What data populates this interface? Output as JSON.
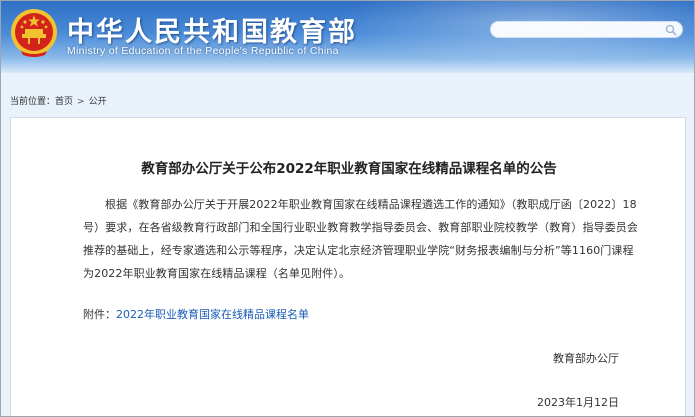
{
  "header": {
    "title": "中华人民共和国教育部",
    "subtitle": "Ministry of Education of the People's Republic of China",
    "search": {
      "value": "",
      "placeholder": ""
    }
  },
  "breadcrumb": {
    "prefix": "当前位置：",
    "items": [
      "首页",
      "公开"
    ],
    "separator": ">"
  },
  "article": {
    "title": "教育部办公厅关于公布2022年职业教育国家在线精品课程名单的公告",
    "body": "根据《教育部办公厅关于开展2022年职业教育国家在线精品课程遴选工作的通知》（教职成厅函〔2022〕18号）要求，在各省级教育行政部门和全国行业职业教育教学指导委员会、教育部职业院校教学（教育）指导委员会推荐的基础上，经专家遴选和公示等程序，决定认定北京经济管理职业学院“财务报表编制与分析”等1160门课程为2022年职业教育国家在线精品课程（名单见附件）。",
    "attachment_label": "附件：",
    "attachment_link": "2022年职业教育国家在线精品课程名单",
    "signature": "教育部办公厅",
    "date": "2023年1月12日"
  },
  "colors": {
    "header_blue": "#2f6fc4",
    "link_blue": "#1a5cb8",
    "emblem_red": "#d4231a",
    "emblem_gold": "#f2c230",
    "page_bg": "#e9f2fb"
  },
  "icons": {
    "emblem": "national-emblem-icon",
    "search": "search-icon"
  }
}
